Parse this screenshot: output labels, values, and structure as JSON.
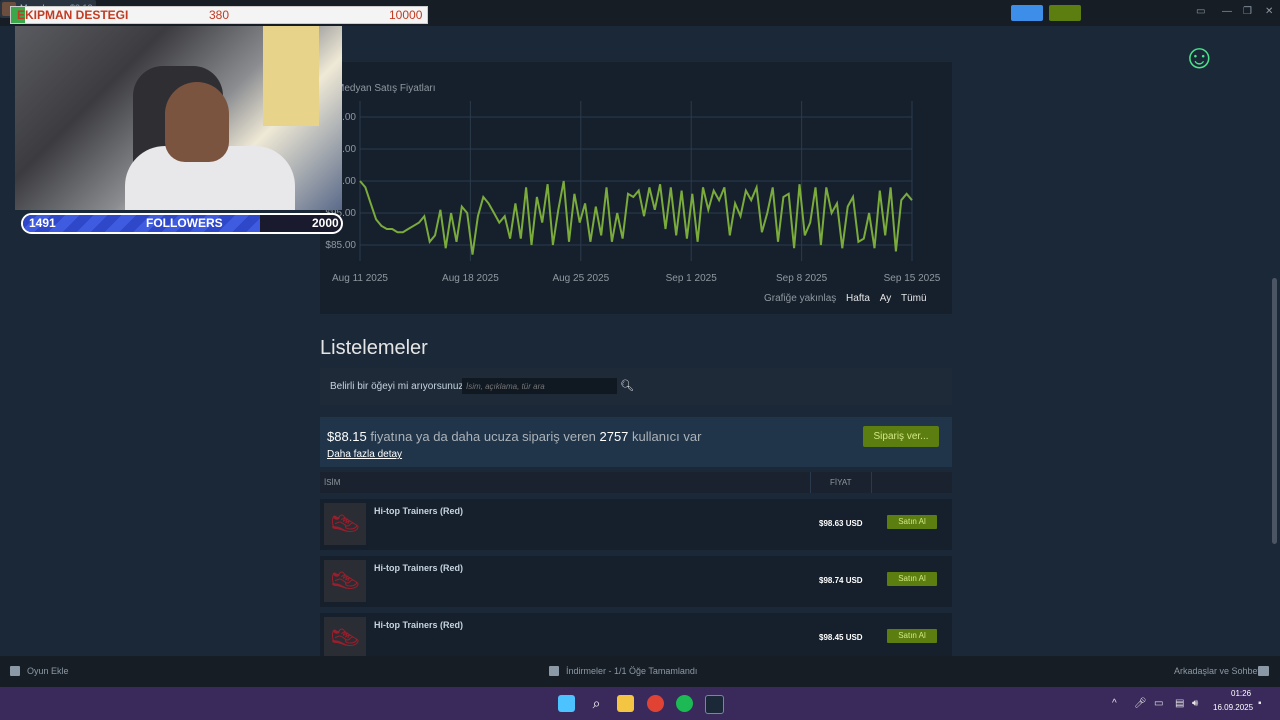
{
  "overlay": {
    "donation_label": "EKIPMAN DESTEGI",
    "donation_current": "380",
    "donation_goal": "10000",
    "followers_count": "1491",
    "followers_label": "FOLLOWERS",
    "followers_goal": "2000"
  },
  "topbar": {
    "username": "Moonberg",
    "balance": "$2.12",
    "colors": {
      "announce": "#3d8ee8",
      "notifications": "#5c7e10"
    }
  },
  "chart_data": {
    "type": "line",
    "title": "Medyan Satış Fiyatları",
    "x_ticks": [
      "Aug 11 2025",
      "Aug 18 2025",
      "Aug 25 2025",
      "Sep 1 2025",
      "Sep 8 2025",
      "Sep 15 2025"
    ],
    "y_ticks": [
      "$85.00",
      "$95.00",
      "$105.00",
      "$115.00",
      "$125.00"
    ],
    "ylim": [
      80,
      130
    ],
    "grid": true,
    "series": [
      {
        "color": "#7aab3b",
        "values": [
          105,
          103,
          98,
          93,
          91,
          90,
          90,
          89,
          89,
          90,
          91,
          92,
          94,
          86,
          88,
          96,
          84,
          95,
          86,
          97,
          95,
          82,
          94,
          100,
          98,
          95,
          92,
          94,
          87,
          98,
          87,
          103,
          85,
          100,
          92,
          104,
          85,
          96,
          105,
          86,
          101,
          92,
          98,
          86,
          97,
          88,
          103,
          86,
          95,
          87,
          101,
          100,
          102,
          94,
          103,
          96,
          104,
          90,
          103,
          88,
          102,
          87,
          101,
          86,
          103,
          96,
          102,
          99,
          103,
          88,
          98,
          94,
          102,
          99,
          103,
          89,
          95,
          103,
          86,
          100,
          101,
          84,
          104,
          88,
          92,
          103,
          85,
          103,
          95,
          98,
          84,
          97,
          100,
          86,
          87,
          95,
          84,
          102,
          88,
          103,
          83,
          99,
          101,
          99
        ]
      }
    ]
  },
  "zoom": {
    "label": "Grafiğe yakınlaş",
    "week": "Hafta",
    "month": "Ay",
    "all": "Tümü"
  },
  "listings": {
    "title": "Listelemeler",
    "search_label": "Belirli bir öğeyi mi arıyorsunuz?",
    "search_placeholder": "İsim, açıklama, tür ara",
    "buy_order": {
      "price": "$88.15",
      "text_mid": "fiyatına ya da daha ucuza sipariş veren",
      "count": "2757",
      "text_end": "kullanıcı var",
      "details": "Daha fazla detay",
      "order_button": "Sipariş ver..."
    },
    "headers": {
      "name": "İSİM",
      "price": "FİYAT"
    },
    "rows": [
      {
        "name": "Hi-top Trainers (Red)",
        "price": "$98.63 USD",
        "buy": "Satın Al"
      },
      {
        "name": "Hi-top Trainers (Red)",
        "price": "$98.74 USD",
        "buy": "Satın Al"
      },
      {
        "name": "Hi-top Trainers (Red)",
        "price": "$98.45 USD",
        "buy": "Satın Al"
      }
    ]
  },
  "bottom_bar": {
    "add_game": "Oyun Ekle",
    "downloads": "İndirmeler - 1/1 Öğe Tamamlandı",
    "friends": "Arkadaşlar ve Sohbet"
  },
  "taskbar": {
    "time": "01:26",
    "date": "16.09.2025"
  }
}
